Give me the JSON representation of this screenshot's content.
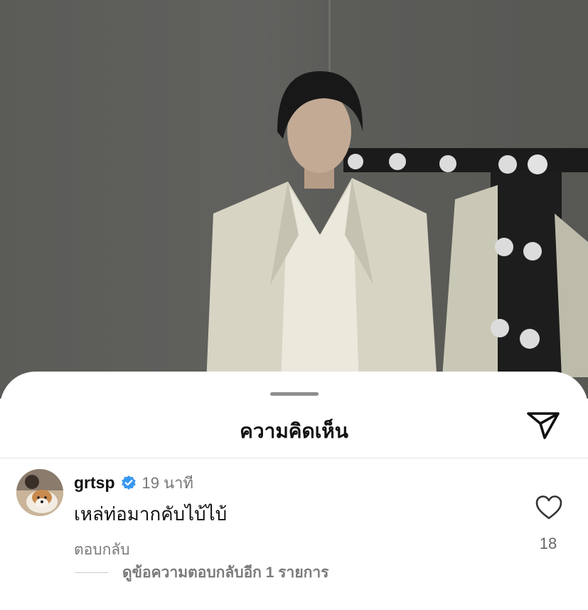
{
  "sheet": {
    "title": "ความคิดเห็น",
    "share_icon": "send-icon"
  },
  "comment": {
    "username": "grtsp",
    "verified_icon": "verified-badge-icon",
    "verified_color": "#3897f0",
    "time": "19 นาที",
    "text": "เหล่ท่อมากคับไบ้ไบ้",
    "reply_label": "ตอบกลับ",
    "like_icon": "heart-icon",
    "like_count": "18",
    "view_replies": "ดูข้อความตอบกลับอีก 1 รายการ"
  }
}
